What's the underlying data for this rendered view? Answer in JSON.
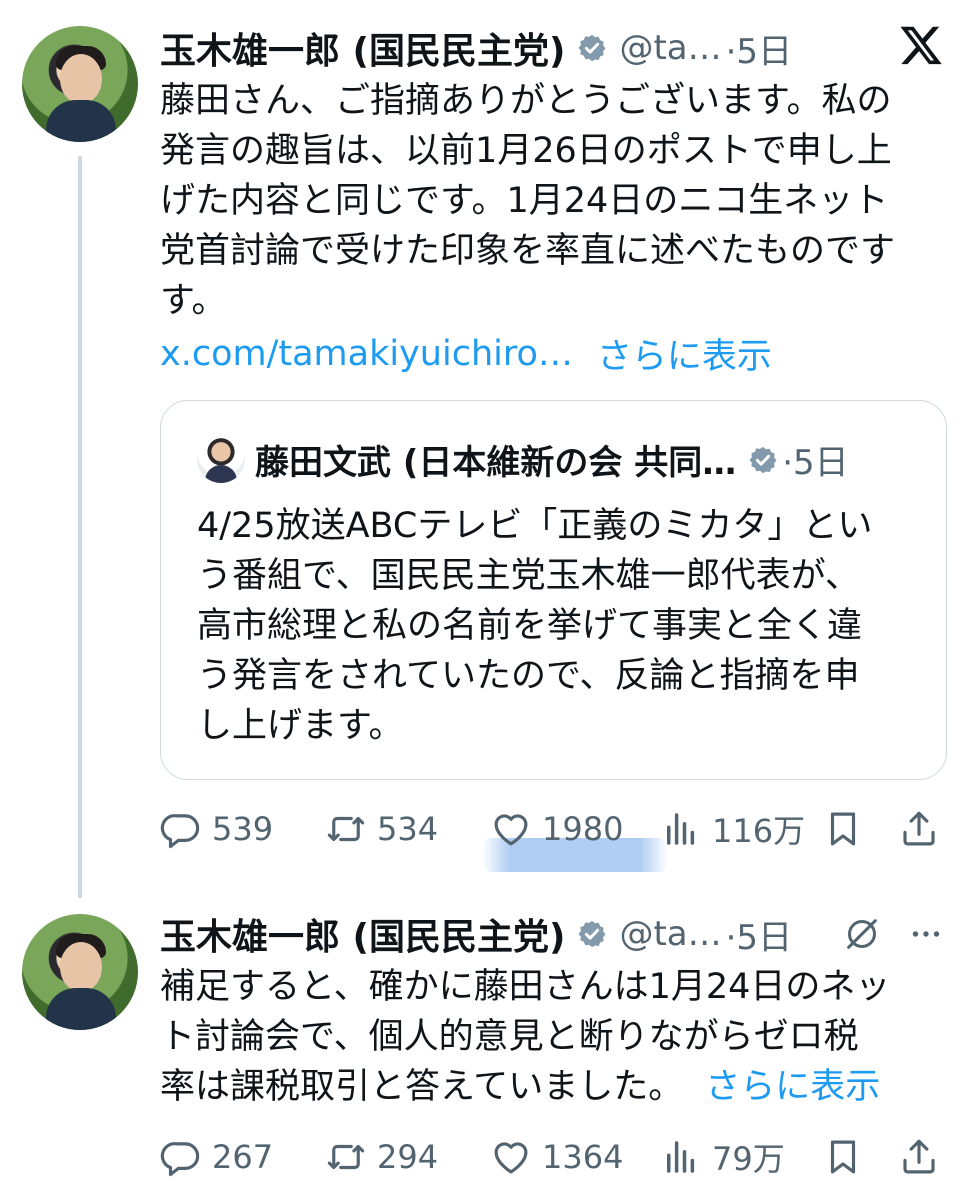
{
  "tweet1": {
    "author": "玉木雄一郎 (国民民主党)",
    "handle": "@ta…",
    "time": "·5日",
    "text": "藤田さん、ご指摘ありがとうございます。私の\n発言の趣旨は、以前1月26日のポストで申し上\nげた内容と同じです。1月24日のニコ生ネット\n党首討論で受けた印象を率直に述べたものです\nす。",
    "link": "x.com/tamakiyuichiro…",
    "show_more": "さらに表示",
    "quote": {
      "author": "藤田文武 (日本維新の会 共同…",
      "time": "·5日",
      "text": "4/25放送ABCテレビ「正義のミカタ」とい\nう番組で、国民民主党玉木雄一郎代表が、\n高市総理と私の名前を挙げて事実と全く違\nう発言をされていたので、反論と指摘を申\nし上げます。"
    },
    "stats": {
      "replies": "539",
      "reposts": "534",
      "likes": "1980",
      "views": "116万"
    }
  },
  "tweet2": {
    "author": "玉木雄一郎 (国民民主党)",
    "handle": "@ta…",
    "time": "·5日",
    "text": "補足すると、確かに藤田さんは1月24日のネッ\nト討論会で、個人的意見と断りながらゼロ税\n率は課税取引と答えていました。",
    "show_more": "さらに表示",
    "stats": {
      "replies": "267",
      "reposts": "294",
      "likes": "1364",
      "views": "79万"
    }
  },
  "icons": {
    "verified": "verified-badge-icon",
    "x_logo": "x-logo-icon",
    "grok": "grok-icon",
    "more": "more-icon",
    "reply": "reply-icon",
    "repost": "repost-icon",
    "like": "like-icon",
    "views": "views-icon",
    "bookmark": "bookmark-icon",
    "share": "share-icon"
  },
  "colors": {
    "link": "#1d9bf0",
    "secondary": "#536471",
    "verified": "#829aab",
    "border": "#cfd9de"
  }
}
